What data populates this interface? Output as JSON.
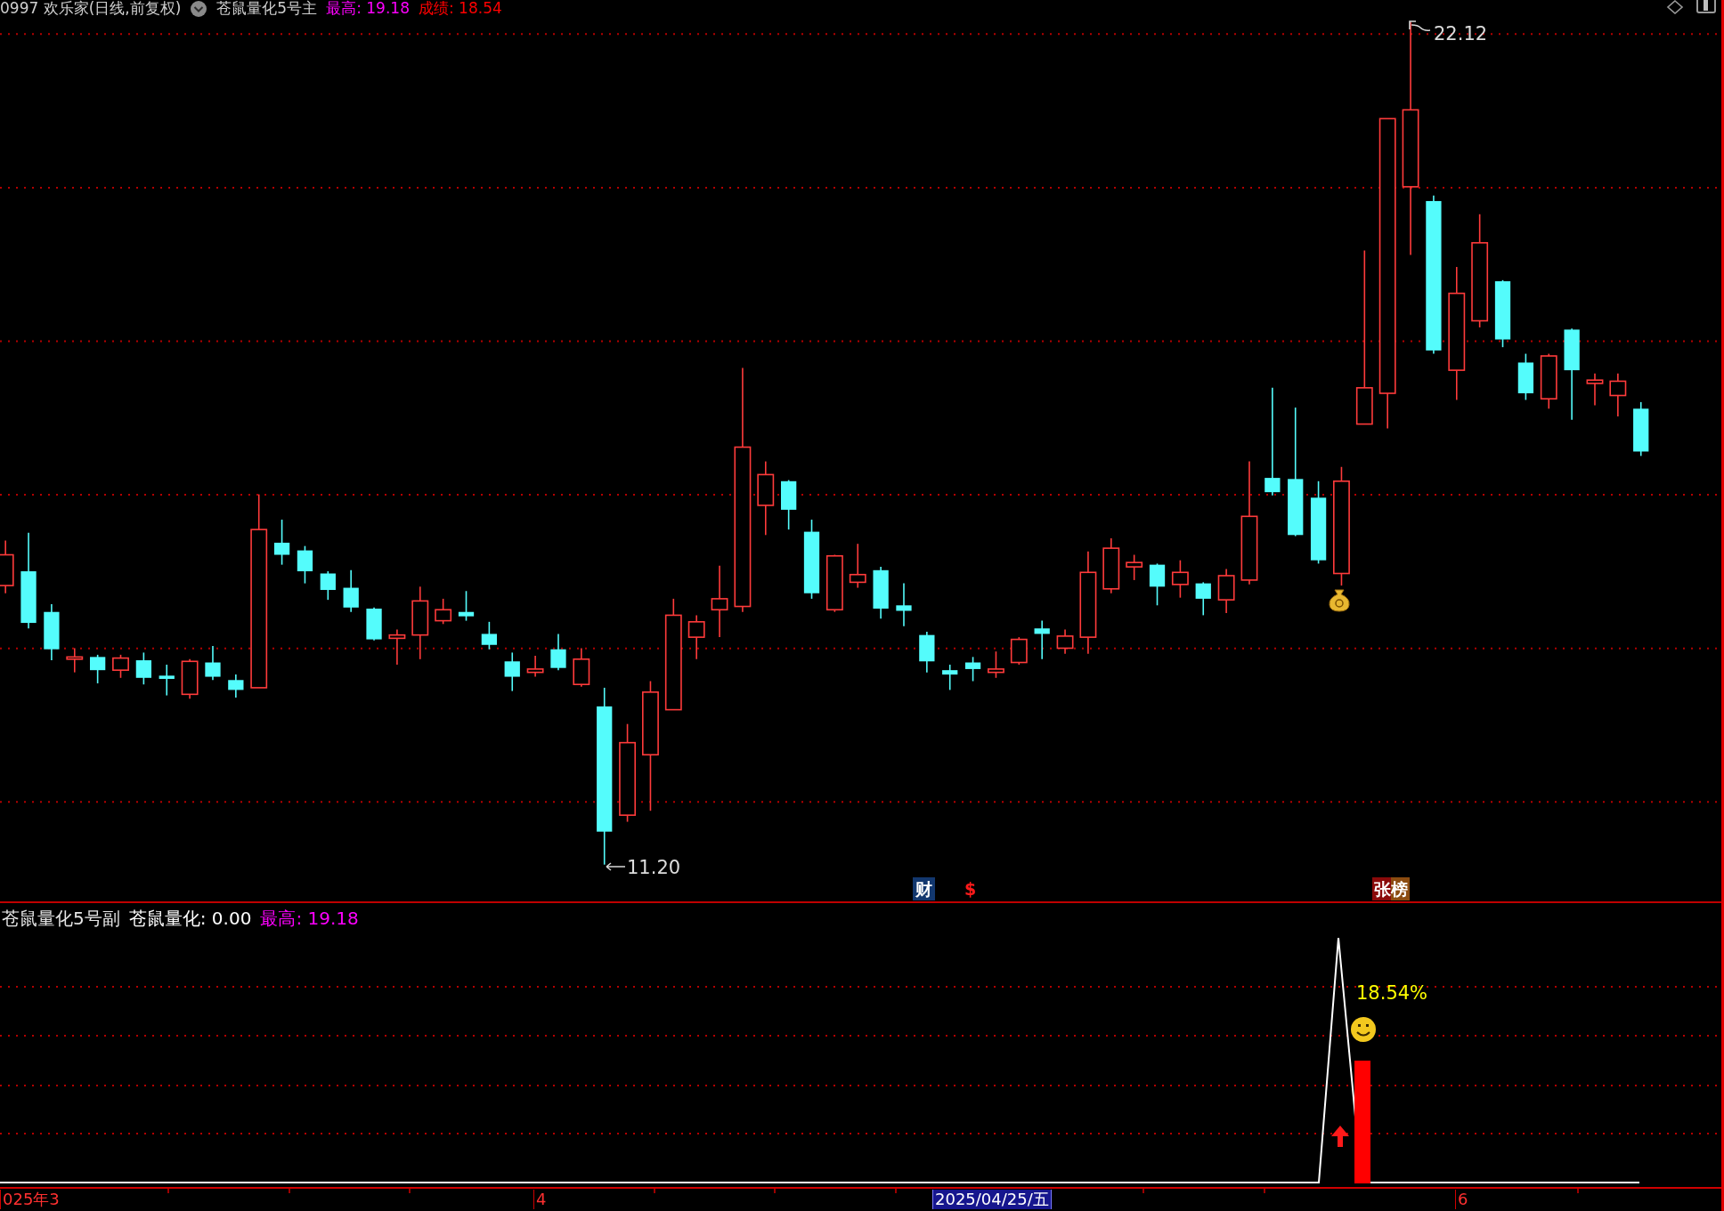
{
  "header": {
    "symbol": "0997 欢乐家(日线,前复权)",
    "formula": "苍鼠量化5号主",
    "fields": [
      {
        "text": "最高: 19.18",
        "color": "#ff00ff"
      },
      {
        "text": "成绩: 18.54",
        "color": "#ff0000"
      }
    ]
  },
  "price_chart": {
    "high_label": "22.12",
    "low_label": "11.20",
    "markers": [
      {
        "kind": "finance",
        "text": "财"
      },
      {
        "kind": "dollar",
        "text": "$"
      },
      {
        "kind": "ranking",
        "text": "张榜"
      }
    ]
  },
  "indicator": {
    "title": "苍鼠量化5号副",
    "fields": [
      {
        "text": "苍鼠量化: 0.00",
        "color": "#ffffff"
      },
      {
        "text": "最高: 19.18",
        "color": "#ff00ff"
      }
    ],
    "peak_label": "18.54%"
  },
  "time_axis": {
    "labels": [
      {
        "text": "025年3",
        "selected": false
      },
      {
        "text": "4",
        "selected": false
      },
      {
        "text": "2025/04/25/五",
        "selected": true
      },
      {
        "text": "6",
        "selected": false
      }
    ]
  }
}
